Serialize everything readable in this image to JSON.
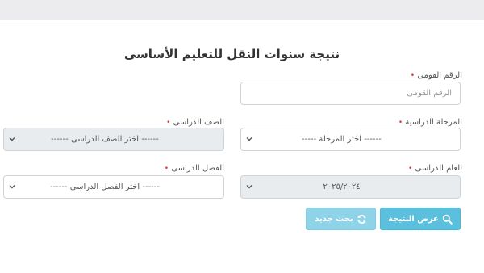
{
  "page_title": "نتيجة سنوات النقل للتعليم الأساسى",
  "required_mark": "•",
  "national_id": {
    "label": "الرقم القومى",
    "placeholder": "الرقم القومى",
    "value": ""
  },
  "stage": {
    "label": "المرحلة الدراسية",
    "selected": "------ اختر المرحلة -----"
  },
  "grade": {
    "label": "الصف الدراسى",
    "selected": "------ اختر الصف الدراسى ------"
  },
  "academic_year": {
    "label": "العام الدراسى",
    "selected": "٢٠٢٥/٢٠٢٤"
  },
  "term": {
    "label": "الفصل الدراسى",
    "selected": "------ اختر الفصل الدراسى ------"
  },
  "buttons": {
    "show_result": "عرض النتيجة",
    "new_search": "بحث جديد"
  },
  "colors": {
    "primary_button": "#5bc0de",
    "secondary_button": "#8fd3e8",
    "required_mark": "#e0383e",
    "disabled_field": "#e9ecef"
  },
  "icons": {
    "show_result": "search-icon",
    "new_search": "refresh-icon",
    "select_arrow": "chevron-down-icon"
  }
}
